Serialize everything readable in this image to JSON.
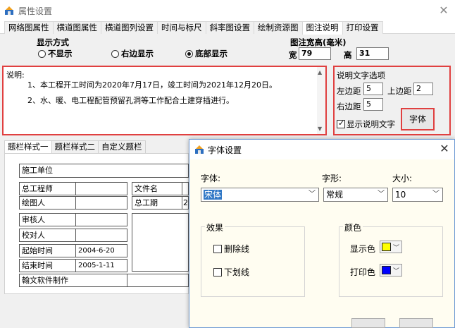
{
  "window": {
    "title": "属性设置",
    "close_glyph": "✕"
  },
  "tabs": [
    "网络图属性",
    "横道图属性",
    "横道图列设置",
    "时间与标尺",
    "斜率图设置",
    "绘制资源图",
    "图注说明",
    "打印设置"
  ],
  "active_tab": 6,
  "display_mode": {
    "title": "显示方式",
    "options": [
      "不显示",
      "右边显示",
      "底部显示"
    ],
    "selected": 2
  },
  "legend_size": {
    "title": "图注宽高(毫米)",
    "width_label": "宽",
    "width_value": "79",
    "height_label": "高",
    "height_value": "31"
  },
  "description": {
    "label": "说明:",
    "lines": [
      "1、本工程开工时间为2020年7月17日，竣工时间为2021年12月20日。",
      "2、水、暖、电工程配管预留孔洞等工作配合土建穿插进行。"
    ]
  },
  "desc_options": {
    "title": "说明文字选项",
    "left_margin_label": "左边距",
    "left_margin_value": "5",
    "top_margin_label": "上边距",
    "top_margin_value": "2",
    "right_margin_label": "右边距",
    "right_margin_value": "5",
    "show_text_label": "显示说明文字",
    "show_text_checked": true,
    "font_button": "字体"
  },
  "title_bar_tabs": [
    "题栏样式一",
    "题栏样式二",
    "自定义题栏"
  ],
  "title_table": {
    "construction_unit": "施工单位",
    "chief_engineer": "总工程师",
    "drafter": "绘图人",
    "reviewer": "审核人",
    "checker": "校对人",
    "start_label": "起始时间",
    "start_value": "2004-6-20",
    "end_label": "结束时间",
    "end_value": "2005-1-11",
    "made_by": "翰文软件制作",
    "filename_label": "文件名",
    "duration_label": "总工期",
    "duration_value_partial": "2"
  },
  "font_dialog": {
    "title": "字体设置",
    "font_label": "字体:",
    "font_value": "宋体",
    "style_label": "字形:",
    "style_value": "常规",
    "size_label": "大小:",
    "size_value": "10",
    "effects_title": "效果",
    "strikethrough_label": "删除线",
    "underline_label": "下划线",
    "color_title": "颜色",
    "display_color_label": "显示色",
    "display_color": "#ffff00",
    "print_color_label": "打印色",
    "print_color": "#0000ff"
  },
  "colors": {
    "highlight_border": "#e04040",
    "selection": "#3178c6"
  }
}
